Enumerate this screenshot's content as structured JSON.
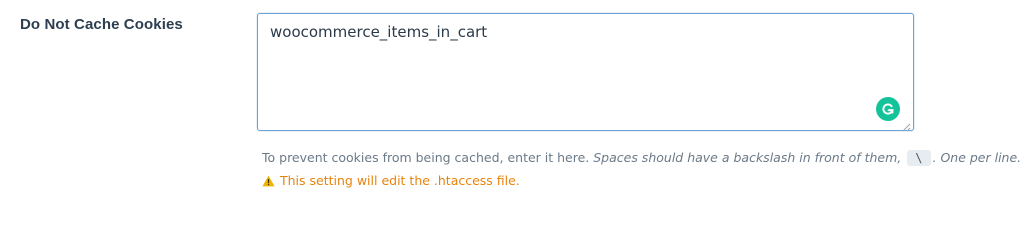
{
  "field": {
    "label": "Do Not Cache Cookies",
    "value": "woocommerce_items_in_cart"
  },
  "help": {
    "text_plain": "To prevent cookies from being cached, enter it here. ",
    "text_italic_1": "Spaces should have a backslash in front of them,",
    "code": "\\",
    "text_italic_2": ". One per line."
  },
  "warning": {
    "text": "This setting will edit the .htaccess file.",
    "icon": "warning-triangle-icon",
    "color": "#e8830c"
  },
  "icons": {
    "grammarly": "grammarly-icon",
    "grammarly_color": "#15c39a"
  }
}
